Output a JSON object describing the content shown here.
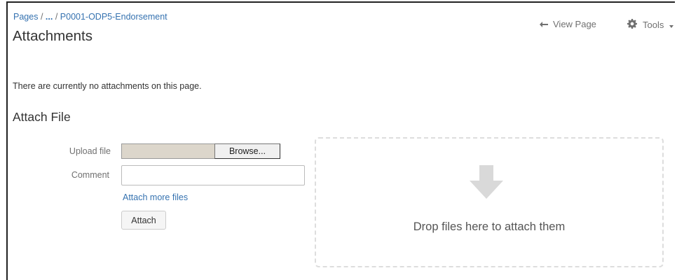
{
  "breadcrumb": {
    "root": "Pages",
    "separator": "/",
    "ellipsis": "...",
    "current": "P0001-ODP5-Endorsement"
  },
  "header": {
    "title": "Attachments",
    "view_page": "View Page",
    "view_page_icon": "back-arrow-icon",
    "tools": "Tools",
    "tools_icon": "gear-icon"
  },
  "notice": "There are currently no attachments on this page.",
  "attach_section": {
    "title": "Attach File",
    "upload_label": "Upload file",
    "browse_label": "Browse...",
    "comment_label": "Comment",
    "comment_value": "",
    "attach_more_label": "Attach more files",
    "attach_button_label": "Attach"
  },
  "dropzone": {
    "text": "Drop files here to attach them",
    "icon": "down-arrow-icon"
  },
  "colors": {
    "link": "#3572b0",
    "text": "#333333",
    "muted": "#707070"
  }
}
